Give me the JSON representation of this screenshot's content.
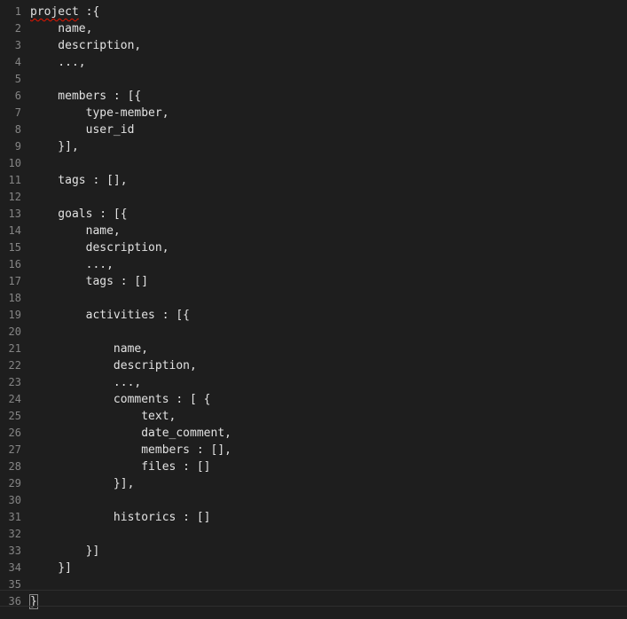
{
  "editor": {
    "first_token": "project",
    "lines": [
      {
        "num": "1",
        "text": " :{"
      },
      {
        "num": "2",
        "text": "    name,"
      },
      {
        "num": "3",
        "text": "    description,"
      },
      {
        "num": "4",
        "text": "    ...,"
      },
      {
        "num": "5",
        "text": ""
      },
      {
        "num": "6",
        "text": "    members : [{"
      },
      {
        "num": "7",
        "text": "        type-member,"
      },
      {
        "num": "8",
        "text": "        user_id"
      },
      {
        "num": "9",
        "text": "    }],"
      },
      {
        "num": "10",
        "text": ""
      },
      {
        "num": "11",
        "text": "    tags : [],"
      },
      {
        "num": "12",
        "text": ""
      },
      {
        "num": "13",
        "text": "    goals : [{"
      },
      {
        "num": "14",
        "text": "        name,"
      },
      {
        "num": "15",
        "text": "        description,"
      },
      {
        "num": "16",
        "text": "        ...,"
      },
      {
        "num": "17",
        "text": "        tags : []"
      },
      {
        "num": "18",
        "text": ""
      },
      {
        "num": "19",
        "text": "        activities : [{"
      },
      {
        "num": "20",
        "text": ""
      },
      {
        "num": "21",
        "text": "            name,"
      },
      {
        "num": "22",
        "text": "            description,"
      },
      {
        "num": "23",
        "text": "            ...,"
      },
      {
        "num": "24",
        "text": "            comments : [ {"
      },
      {
        "num": "25",
        "text": "                text,"
      },
      {
        "num": "26",
        "text": "                date_comment,"
      },
      {
        "num": "27",
        "text": "                members : [],"
      },
      {
        "num": "28",
        "text": "                files : []"
      },
      {
        "num": "29",
        "text": "            }],"
      },
      {
        "num": "30",
        "text": ""
      },
      {
        "num": "31",
        "text": "            historics : []"
      },
      {
        "num": "32",
        "text": ""
      },
      {
        "num": "33",
        "text": "        }]"
      },
      {
        "num": "34",
        "text": "    }]"
      },
      {
        "num": "35",
        "text": ""
      },
      {
        "num": "36",
        "text": "}"
      }
    ]
  },
  "colors": {
    "background": "#1e1e1e",
    "text": "#e2e2e2",
    "line_number": "#858585",
    "error_squiggle": "#e51400"
  }
}
